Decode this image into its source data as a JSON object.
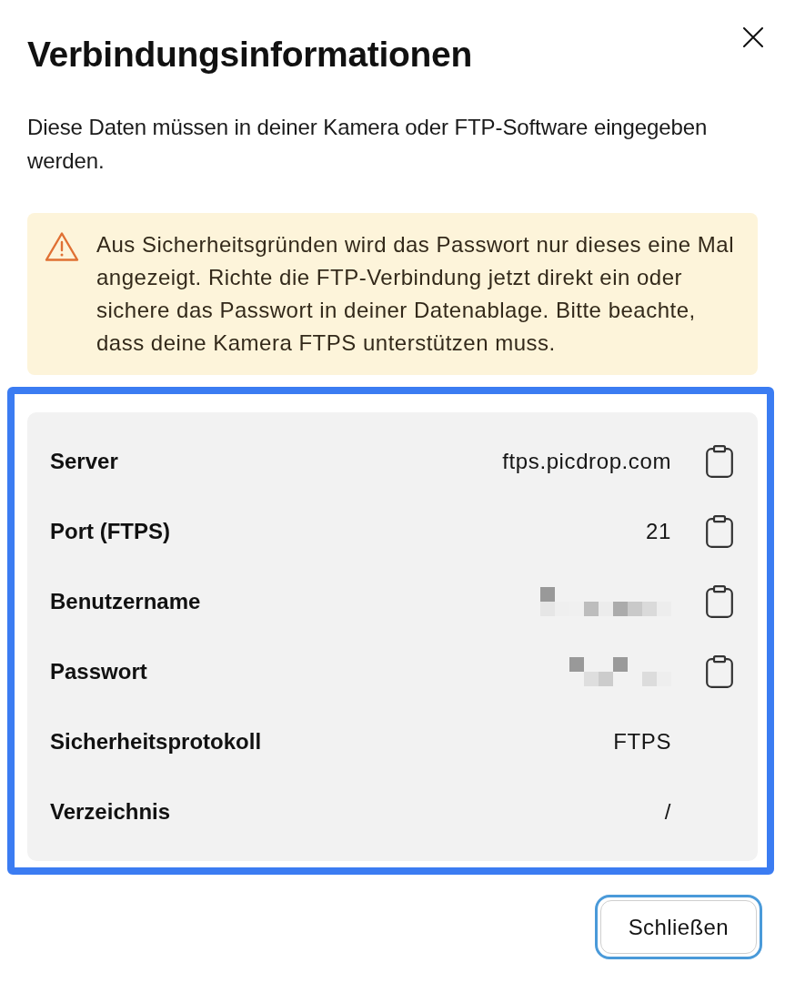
{
  "dialog": {
    "title": "Verbindungsinformationen",
    "description": "Diese Daten müssen in deiner Kamera oder FTP-Software eingegeben werden."
  },
  "warning": {
    "text": "Aus Sicherheitsgründen wird das Passwort nur dieses eine Mal angezeigt. Richte die FTP-Verbindung jetzt direkt ein oder sichere das Passwort in deiner Datenablage. Bitte beachte, dass deine Kamera FTPS unterstützen muss."
  },
  "details": {
    "highlighted": true,
    "rows": [
      {
        "label": "Server",
        "kind": "text",
        "value": "ftps.picdrop.com",
        "copyable": true
      },
      {
        "label": "Port (FTPS)",
        "kind": "text",
        "value": "21",
        "copyable": true
      },
      {
        "label": "Benutzername",
        "kind": "redacted",
        "copyable": true
      },
      {
        "label": "Passwort",
        "kind": "redacted",
        "copyable": true
      },
      {
        "label": "Sicherheitsprotokoll",
        "kind": "text",
        "value": "FTPS",
        "copyable": false
      },
      {
        "label": "Verzeichnis",
        "kind": "text",
        "value": "/",
        "copyable": false
      }
    ]
  },
  "footer": {
    "button": {
      "label": "Schließen",
      "focused": true
    }
  }
}
